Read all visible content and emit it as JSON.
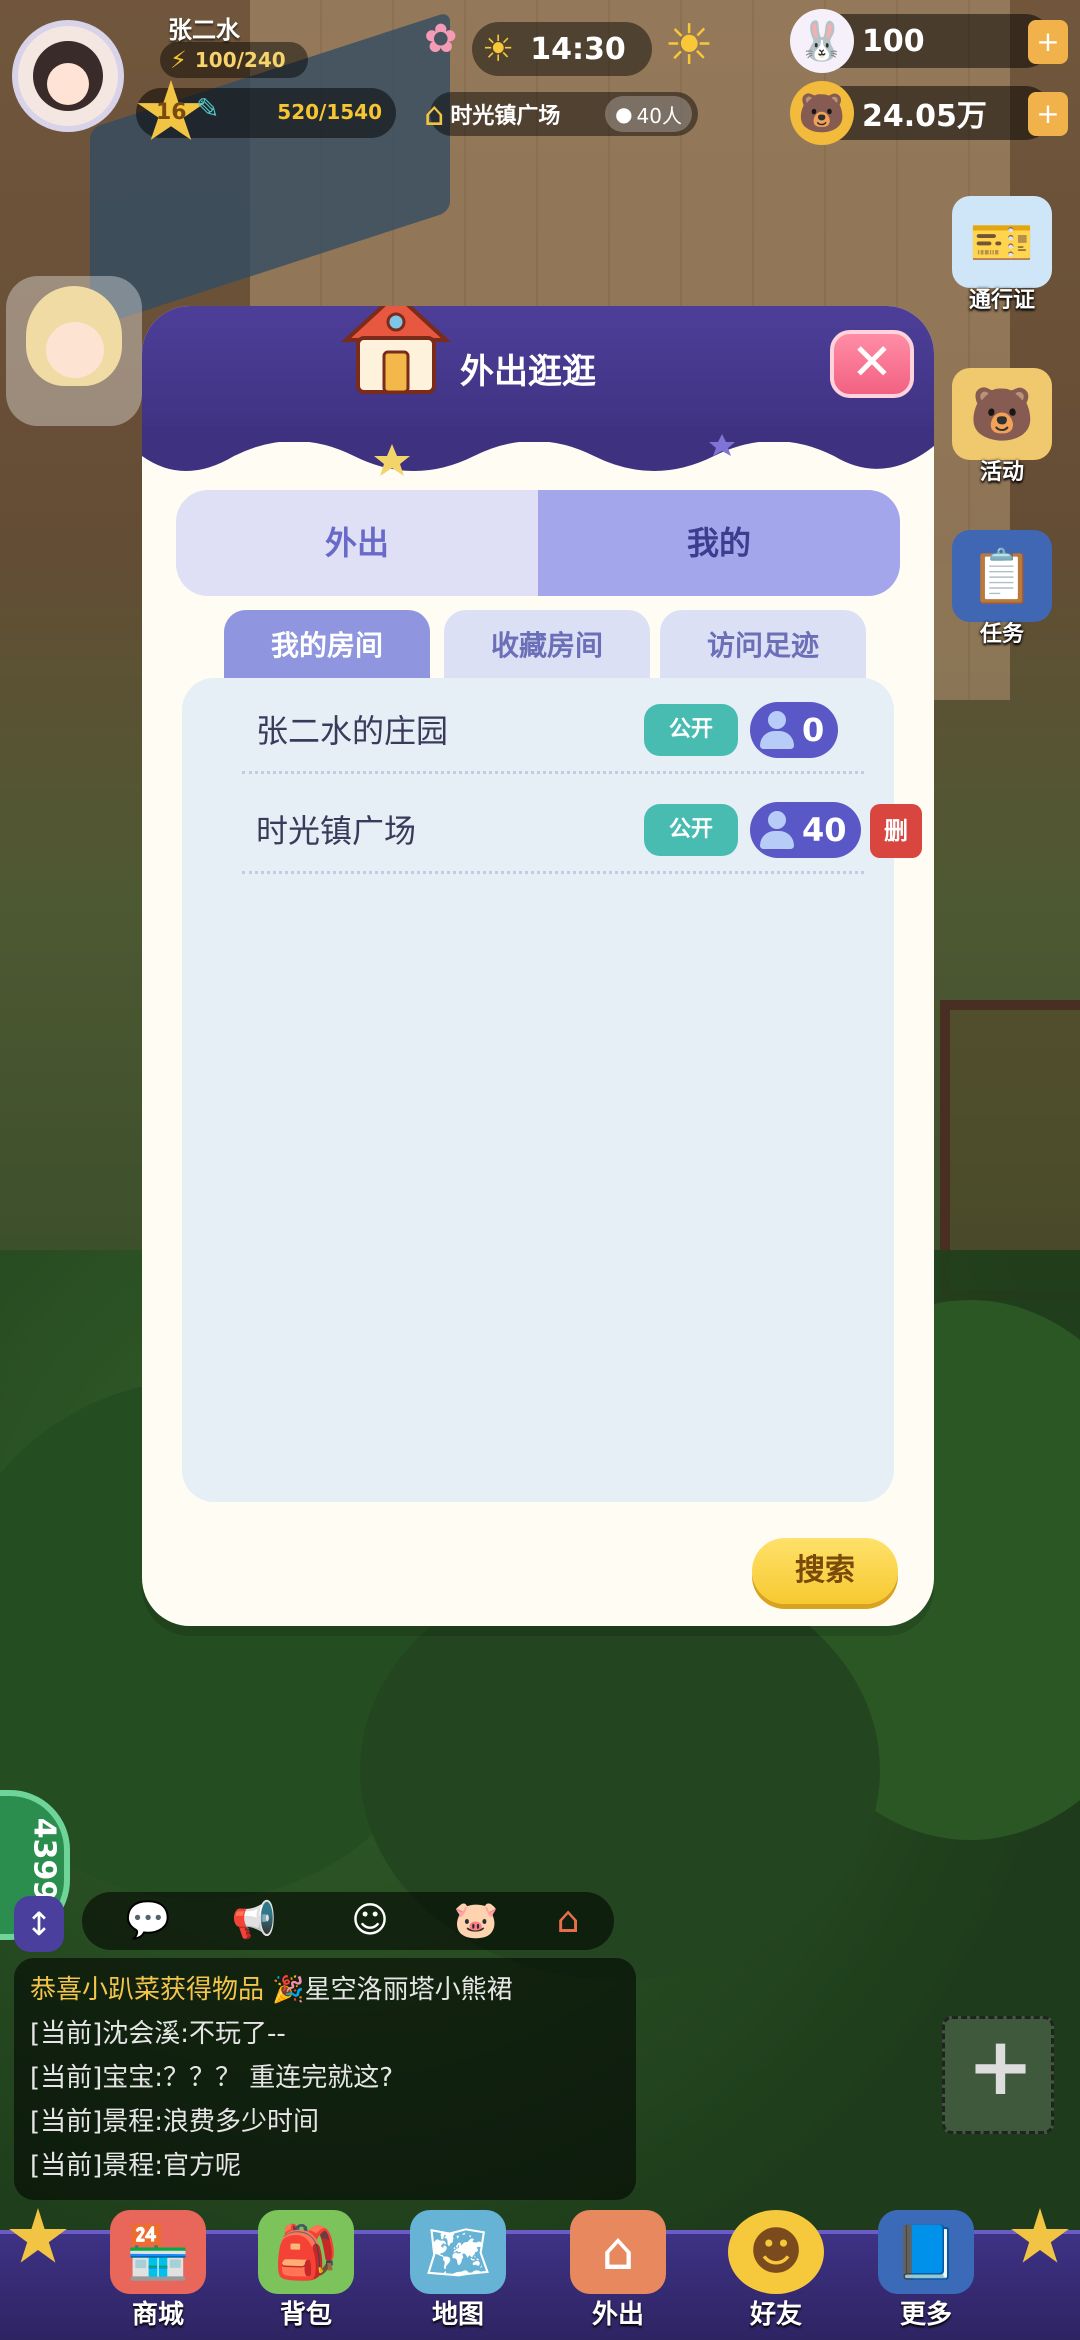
{
  "player": {
    "name": "张二水",
    "energy": "100/240",
    "level": "16",
    "exp": "520/1540"
  },
  "status": {
    "time": "14:30",
    "location": "时光镇广场",
    "online_count": "40人"
  },
  "currency": {
    "gems": "100",
    "coins": "24.05万"
  },
  "side_buttons": {
    "pass": "通行证",
    "activity": "活动",
    "task": "任务"
  },
  "dialog": {
    "title": "外出逛逛",
    "close": "✕",
    "segments": [
      "外出",
      "我的"
    ],
    "subtabs": [
      "我的房间",
      "收藏房间",
      "访问足迹"
    ],
    "rooms": [
      {
        "name": "张二水的庄园",
        "visibility": "公开",
        "users": "0"
      },
      {
        "name": "时光镇广场",
        "visibility": "公开",
        "users": "40",
        "delete": "删"
      }
    ],
    "search": "搜索"
  },
  "chat": {
    "gauge": "4399",
    "lines": [
      {
        "prefix": "恭喜小趴菜",
        "action": "获得物品",
        "item": "星空洛丽塔小熊裙"
      },
      {
        "text": "[当前]沈会溪:不玩了--"
      },
      {
        "text": "[当前]宝宝:？？？ 重连完就这?"
      },
      {
        "text": "[当前]景程:浪费多少时间"
      },
      {
        "text": "[当前]景程:官方呢"
      }
    ]
  },
  "nav": {
    "shop": "商城",
    "bag": "背包",
    "map": "地图",
    "out": "外出",
    "friends": "好友",
    "more": "更多"
  }
}
